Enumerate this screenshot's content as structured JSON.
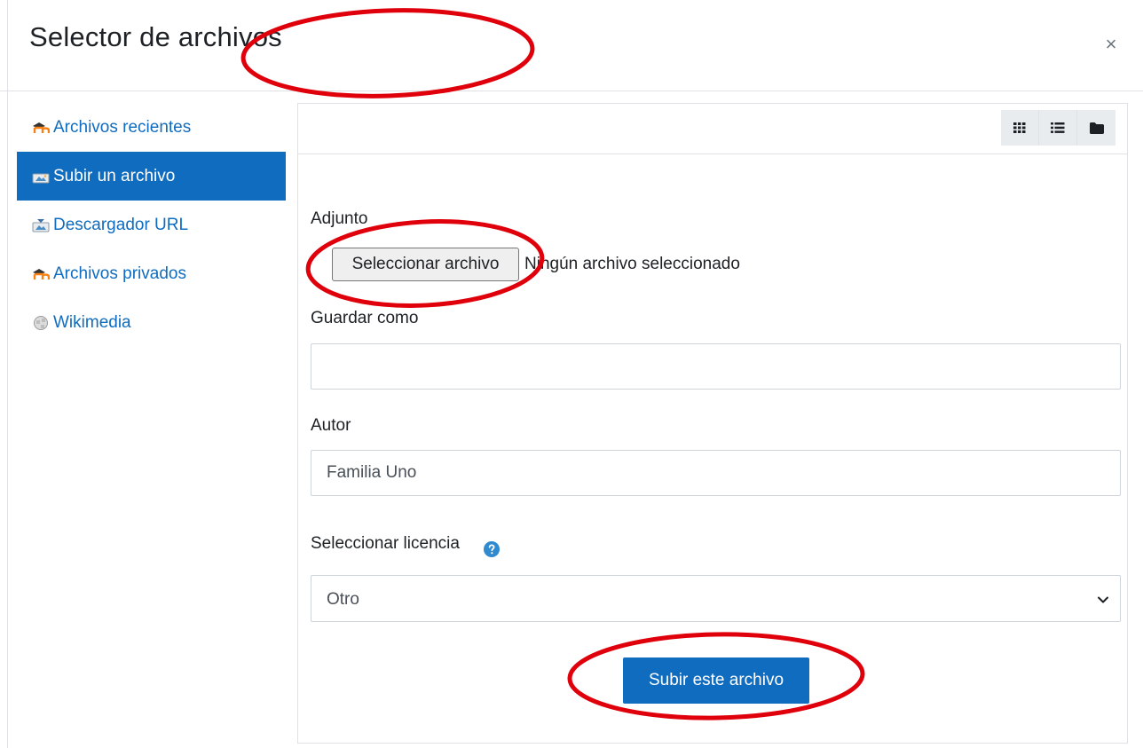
{
  "dialog": {
    "title": "Selector de archivos",
    "close_symbol": "×"
  },
  "sidebar": {
    "items": [
      {
        "label": "Archivos recientes",
        "icon": "moodle-icon",
        "active": false
      },
      {
        "label": "Subir un archivo",
        "icon": "upload-icon",
        "active": true
      },
      {
        "label": "Descargador URL",
        "icon": "url-download-icon",
        "active": false
      },
      {
        "label": "Archivos privados",
        "icon": "moodle-icon",
        "active": false
      },
      {
        "label": "Wikimedia",
        "icon": "wikimedia-icon",
        "active": false
      }
    ]
  },
  "toolbar": {
    "view_buttons": [
      "grid-view-icon",
      "list-view-icon",
      "folder-view-icon"
    ]
  },
  "form": {
    "attachment_label": "Adjunto",
    "file_button_label": "Seleccionar archivo",
    "file_status": "Ningún archivo seleccionado",
    "save_as_label": "Guardar como",
    "save_as_value": "",
    "author_label": "Autor",
    "author_value": "Familia Uno",
    "license_label": "Seleccionar licencia",
    "license_value": "Otro",
    "submit_label": "Subir este archivo"
  },
  "colors": {
    "accent": "#0f6cbf",
    "annotation": "#e0000b",
    "help_icon": "#2f8ad0"
  }
}
